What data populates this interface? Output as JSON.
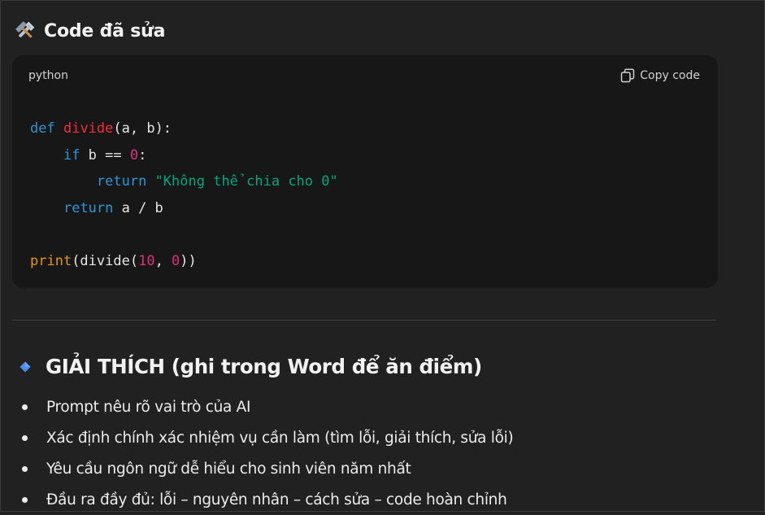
{
  "fixed_section": {
    "icon": "hammer-and-wrench-icon",
    "title": "Code đã sửa"
  },
  "code_block": {
    "language": "python",
    "copy_label": "Copy code",
    "copy_icon": "copy-icon",
    "lines": [
      [
        {
          "t": "def",
          "c": "kw"
        },
        {
          "t": " "
        },
        {
          "t": "divide",
          "c": "fn"
        },
        {
          "t": "(a, b):"
        }
      ],
      [
        {
          "t": "    "
        },
        {
          "t": "if",
          "c": "kw"
        },
        {
          "t": " b == "
        },
        {
          "t": "0",
          "c": "num"
        },
        {
          "t": ":"
        }
      ],
      [
        {
          "t": "        "
        },
        {
          "t": "return",
          "c": "kw"
        },
        {
          "t": " "
        },
        {
          "t": "\"Không thể chia cho 0\"",
          "c": "str"
        }
      ],
      [
        {
          "t": "    "
        },
        {
          "t": "return",
          "c": "kw"
        },
        {
          "t": " a / b"
        }
      ],
      [],
      [
        {
          "t": "print",
          "c": "bi"
        },
        {
          "t": "(divide("
        },
        {
          "t": "10",
          "c": "num"
        },
        {
          "t": ", "
        },
        {
          "t": "0",
          "c": "num"
        },
        {
          "t": "))"
        }
      ]
    ]
  },
  "explanation": {
    "icon": "blue-diamond-icon",
    "heading": "GIẢI THÍCH (ghi trong Word để ăn điểm)",
    "items": [
      "Prompt nêu rõ vai trò của AI",
      "Xác định chính xác nhiệm vụ cần làm (tìm lỗi, giải thích, sửa lỗi)",
      "Yêu cầu ngôn ngữ dễ hiểu cho sinh viên năm nhất",
      "Đầu ra đầy đủ: lỗi – nguyên nhân – cách sửa – code hoàn chỉnh"
    ]
  },
  "colors": {
    "background": "#212121",
    "code_background": "#171717",
    "keyword": "#2e95d3",
    "function_name": "#f22c3d",
    "number": "#df3079",
    "string": "#00a67d",
    "builtin": "#e9950c",
    "diamond": "#4a8ff0"
  }
}
